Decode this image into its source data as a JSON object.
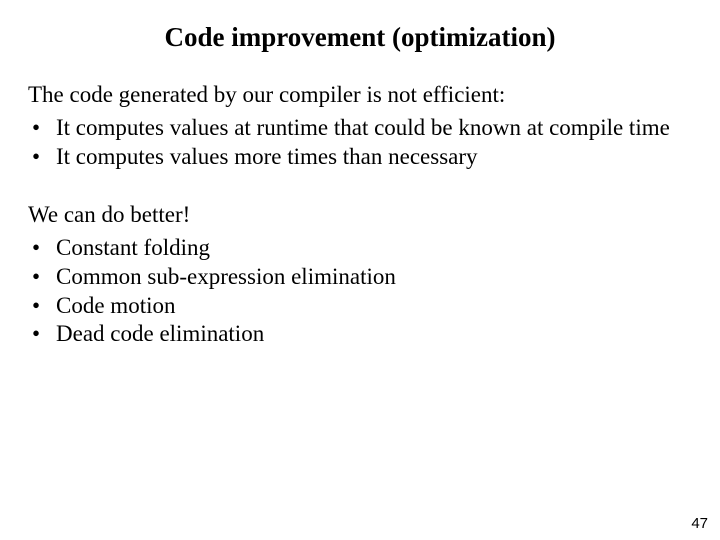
{
  "title": "Code improvement (optimization)",
  "intro1": "The code generated by our compiler is not efficient:",
  "list1": [
    "It computes values at runtime that could be known at compile time",
    "It computes values more times than necessary"
  ],
  "intro2": "We can do better!",
  "list2": [
    "Constant folding",
    "Common sub-expression elimination",
    "Code motion",
    "Dead code elimination"
  ],
  "page_number": "47"
}
